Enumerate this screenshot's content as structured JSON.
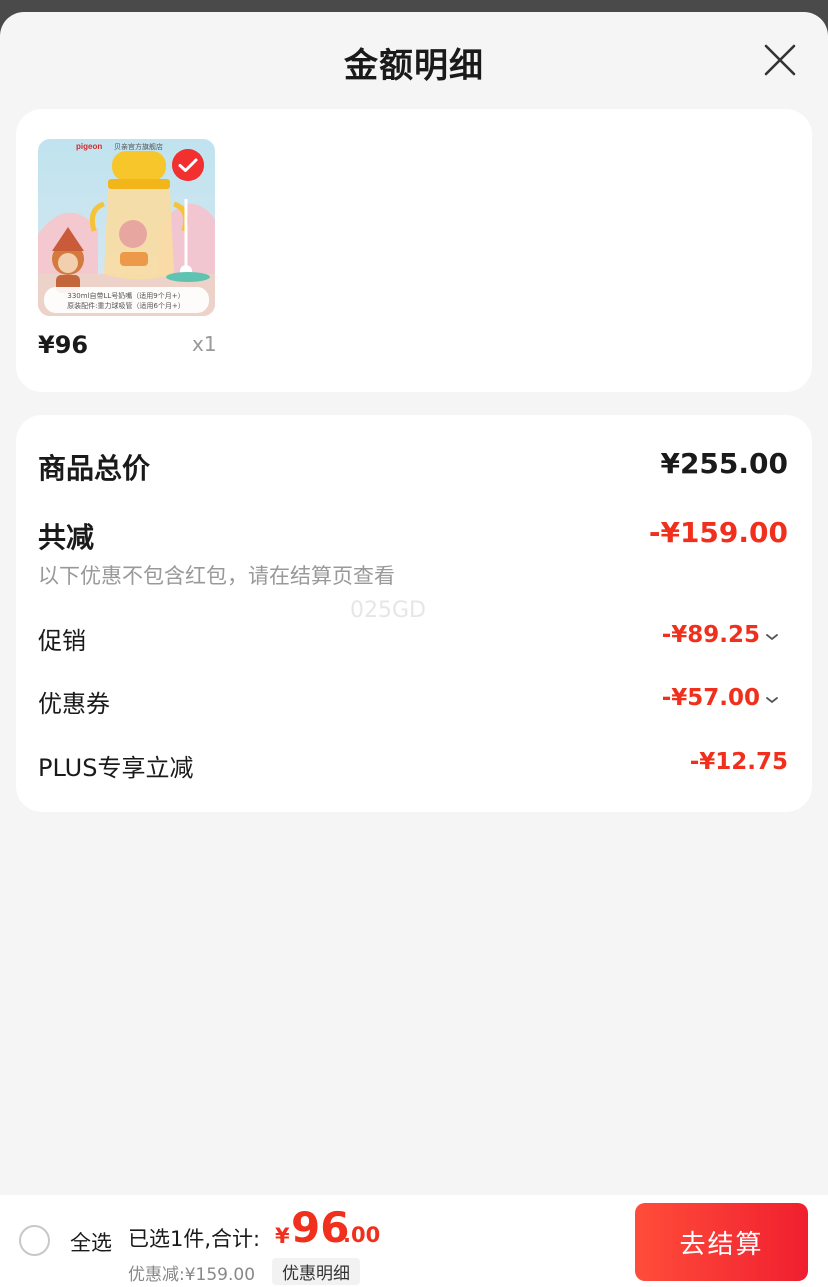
{
  "header": {
    "title": "金额明细"
  },
  "product": {
    "brand": "pigeon",
    "store": "贝亲官方旗舰店",
    "caption_line1": "330ml自带LL号奶嘴（适用9个月+）",
    "caption_line2": "原装配件:重力球吸管（适用6个月+）",
    "price": "¥96",
    "quantity": "x1"
  },
  "summary": {
    "total_label": "商品总价",
    "total_value": "¥255.00",
    "reduce_label": "共减",
    "reduce_value": "-¥159.00",
    "note": "以下优惠不包含红包，请在结算页查看",
    "watermark": "025GD",
    "items": [
      {
        "label": "促销",
        "value": "-¥89.25"
      },
      {
        "label": "优惠券",
        "value": "-¥57.00"
      },
      {
        "label": "PLUS专享立减",
        "value": "-¥12.75"
      }
    ]
  },
  "bottom_bar": {
    "select_all": "全选",
    "selected_text": "已选1件,合计:",
    "currency": "¥",
    "total_int": "96",
    "total_dec": ".00",
    "discount_text": "优惠减:¥159.00",
    "detail_button": "优惠明细",
    "checkout_button": "去结算"
  },
  "colors": {
    "accent_red": "#f0301c",
    "background": "#f5f5f5"
  },
  "icons": {
    "close": "close-icon",
    "check": "check-icon",
    "chevron": "chevron-down-icon"
  }
}
